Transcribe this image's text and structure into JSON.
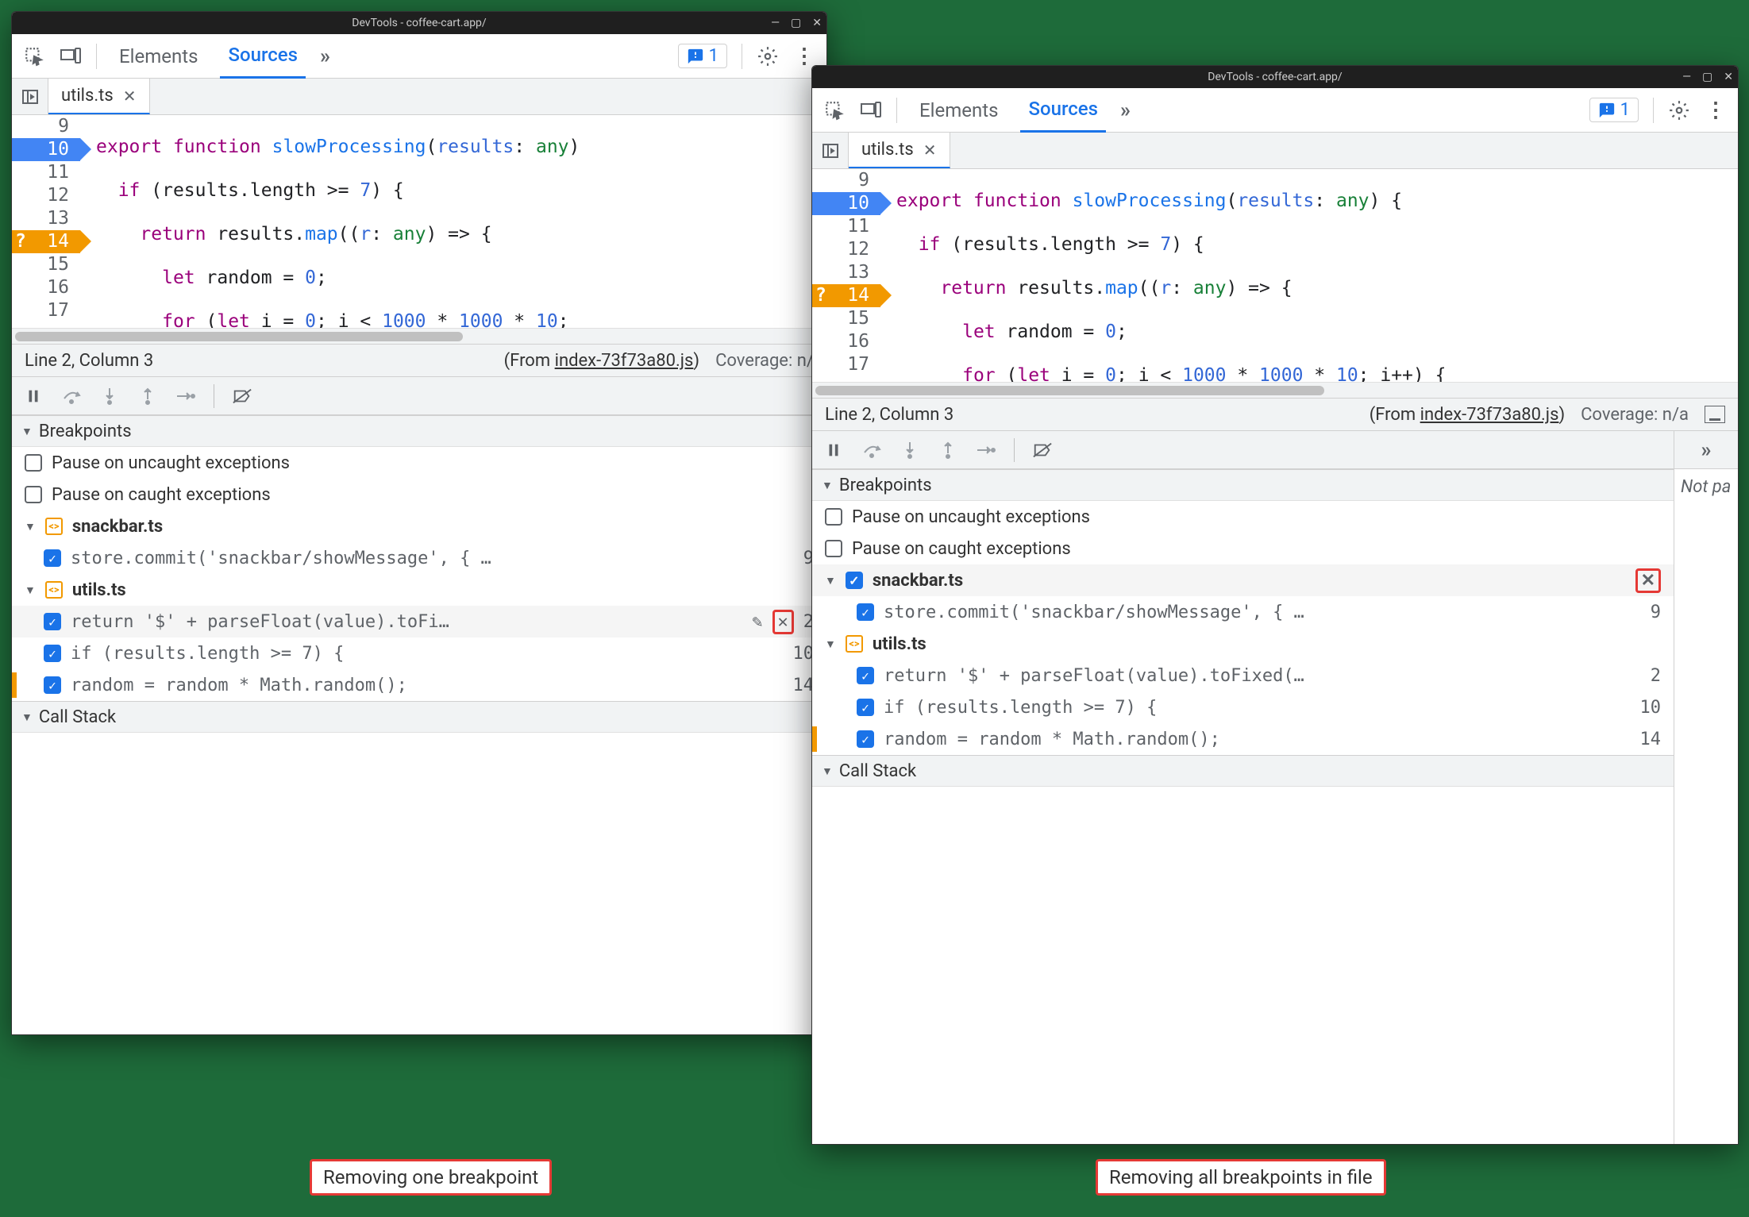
{
  "windows": {
    "left": {
      "title": "DevTools - coffee-cart.app/",
      "tabs": {
        "elements": "Elements",
        "sources": "Sources"
      },
      "issues_count": "1",
      "file_tab": "utils.ts",
      "gutter": [
        "9",
        "10",
        "11",
        "12",
        "13",
        "14",
        "15",
        "16",
        "17"
      ],
      "status": {
        "pos": "Line 2, Column 3",
        "from_prefix": "(From ",
        "from_file": "index-73f73a80.js",
        "from_suffix": ")",
        "coverage": "Coverage: n/"
      },
      "sections": {
        "breakpoints": "Breakpoints",
        "callstack": "Call Stack"
      },
      "pause_uncaught": "Pause on uncaught exceptions",
      "pause_caught": "Pause on caught exceptions",
      "files": [
        {
          "name": "snackbar.ts",
          "rows": [
            {
              "code": "store.commit('snackbar/showMessage', { …",
              "line": "9",
              "checked": true
            }
          ]
        },
        {
          "name": "utils.ts",
          "rows": [
            {
              "code": "return '$' + parseFloat(value).toFi…",
              "line": "2",
              "checked": true,
              "actions": true
            },
            {
              "code": "if (results.length >= 7) {",
              "line": "10",
              "checked": true
            },
            {
              "code": "random = random * Math.random();",
              "line": "14",
              "checked": true,
              "strip": true
            }
          ]
        }
      ],
      "caption": "Removing one breakpoint"
    },
    "right": {
      "title": "DevTools - coffee-cart.app/",
      "tabs": {
        "elements": "Elements",
        "sources": "Sources"
      },
      "issues_count": "1",
      "file_tab": "utils.ts",
      "gutter": [
        "9",
        "10",
        "11",
        "12",
        "13",
        "14",
        "15",
        "16",
        "17"
      ],
      "status": {
        "pos": "Line 2, Column 3",
        "from_prefix": "(From ",
        "from_file": "index-73f73a80.js",
        "from_suffix": ")",
        "coverage": "Coverage: n/a"
      },
      "not_paused": "Not pa",
      "sections": {
        "breakpoints": "Breakpoints",
        "callstack": "Call Stack"
      },
      "pause_uncaught": "Pause on uncaught exceptions",
      "pause_caught": "Pause on caught exceptions",
      "files": [
        {
          "name": "snackbar.ts",
          "file_x": true,
          "rows": [
            {
              "code": "store.commit('snackbar/showMessage', { …",
              "line": "9",
              "checked": true
            }
          ]
        },
        {
          "name": "utils.ts",
          "rows": [
            {
              "code": "return '$' + parseFloat(value).toFixed(…",
              "line": "2",
              "checked": true
            },
            {
              "code": "if (results.length >= 7) {",
              "line": "10",
              "checked": true
            },
            {
              "code": "random = random * Math.random();",
              "line": "14",
              "checked": true,
              "strip": true
            }
          ]
        }
      ],
      "caption": "Removing all breakpoints in file"
    }
  }
}
